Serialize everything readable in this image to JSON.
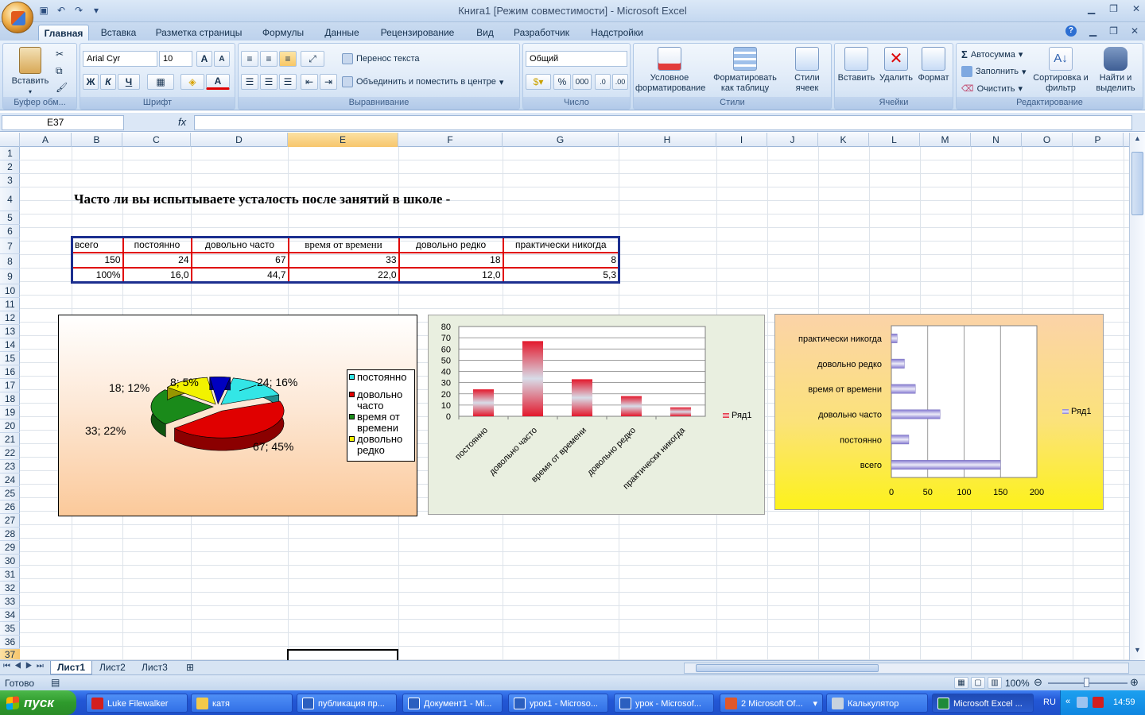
{
  "window": {
    "title": "Книга1  [Режим совместимости] - Microsoft Excel"
  },
  "ribbon_tabs": [
    "Главная",
    "Вставка",
    "Разметка страницы",
    "Формулы",
    "Данные",
    "Рецензирование",
    "Вид",
    "Разработчик",
    "Надстройки"
  ],
  "ribbon": {
    "clipboard": {
      "paste": "Вставить",
      "label": "Буфер обм..."
    },
    "font": {
      "name": "Arial Cyr",
      "size": "10",
      "bold": "Ж",
      "italic": "К",
      "underline": "Ч",
      "label": "Шрифт"
    },
    "align": {
      "wrap": "Перенос текста",
      "merge": "Объединить и поместить в центре",
      "label": "Выравнивание"
    },
    "number": {
      "format": "Общий",
      "percent": "%",
      "thousands": "000",
      "label": "Число"
    },
    "styles": {
      "conditional": "Условное форматирование",
      "as_table": "Форматировать как таблицу",
      "cell_styles": "Стили ячеек",
      "label": "Стили"
    },
    "cells": {
      "insert": "Вставить",
      "delete": "Удалить",
      "format": "Формат",
      "label": "Ячейки"
    },
    "editing": {
      "autosum": "Автосумма",
      "fill": "Заполнить",
      "clear": "Очистить",
      "sort": "Сортировка и фильтр",
      "find": "Найти и выделить",
      "label": "Редактирование"
    }
  },
  "formula_bar": {
    "name_box": "E37",
    "fx": "fx",
    "value": ""
  },
  "columns": [
    "A",
    "B",
    "C",
    "D",
    "E",
    "F",
    "G",
    "H",
    "I",
    "J",
    "K",
    "L",
    "M",
    "N",
    "O",
    "P"
  ],
  "rows": [
    "1",
    "2",
    "3",
    "4",
    "5",
    "6",
    "7",
    "8",
    "9",
    "10",
    "11",
    "12",
    "13",
    "14",
    "15",
    "16",
    "17",
    "18",
    "19",
    "20",
    "21",
    "22",
    "23",
    "24",
    "25",
    "26",
    "27",
    "28",
    "29",
    "30",
    "31",
    "32",
    "33",
    "34",
    "35",
    "36",
    "37"
  ],
  "sheet": {
    "question": "Часто ли вы испытываете усталость после занятий в школе -",
    "table": {
      "headers": [
        "всего",
        "постоянно",
        "довольно часто",
        "время от времени",
        "довольно редко",
        "практически никогда"
      ],
      "counts": [
        "150",
        "24",
        "67",
        "33",
        "18",
        "8"
      ],
      "percents": [
        "100%",
        "16,0",
        "44,7",
        "22,0",
        "12,0",
        "5,3"
      ]
    }
  },
  "chart_data": [
    {
      "type": "pie",
      "categories": [
        "постоянно",
        "довольно часто",
        "время от времени",
        "довольно редко",
        "практически никогда"
      ],
      "values": [
        24,
        67,
        33,
        18,
        8
      ],
      "data_labels": [
        "24; 16%",
        "67; 45%",
        "33; 22%",
        "18; 12%",
        "8; 5%"
      ],
      "legend": [
        "постоянно",
        "довольно часто",
        "время от времени",
        "довольно редко"
      ],
      "colors": [
        "#33e6e6",
        "#e00000",
        "#1a8a1a",
        "#f2f200",
        "#0000c0"
      ],
      "legend_position": "right"
    },
    {
      "type": "bar",
      "categories": [
        "постоянно",
        "довольно часто",
        "время от времени",
        "довольно редко",
        "практически никогда"
      ],
      "series": [
        {
          "name": "Ряд1",
          "values": [
            24,
            67,
            33,
            18,
            8
          ]
        }
      ],
      "ylim": [
        0,
        80
      ],
      "yticks": [
        "0",
        "10",
        "20",
        "30",
        "40",
        "50",
        "60",
        "70",
        "80"
      ],
      "grid": true,
      "legend_position": "right"
    },
    {
      "type": "bar",
      "orientation": "horizontal",
      "categories": [
        "всего",
        "постоянно",
        "довольно часто",
        "время от времени",
        "довольно редко",
        "практически никогда"
      ],
      "series": [
        {
          "name": "Ряд1",
          "values": [
            150,
            24,
            67,
            33,
            18,
            8
          ]
        }
      ],
      "xlim": [
        0,
        200
      ],
      "xticks": [
        "0",
        "50",
        "100",
        "150",
        "200"
      ],
      "grid": true,
      "legend_position": "right"
    }
  ],
  "sheet_tabs": [
    "Лист1",
    "Лист2",
    "Лист3"
  ],
  "status": {
    "ready": "Готово",
    "zoom": "100%"
  },
  "taskbar": {
    "start": "пуск",
    "items": [
      "Luke Filewalker",
      "катя",
      "публикация пр...",
      "Документ1 - Mi...",
      "урок1 - Microso...",
      "урок - Microsof...",
      "2 Microsoft Of...",
      "Калькулятор",
      "Microsoft Excel ..."
    ],
    "lang": "RU",
    "time": "14:59"
  },
  "colors": {
    "accent": "#1e4fc9",
    "table_border": "#e00000",
    "table_outer": "#1c2f8f"
  }
}
